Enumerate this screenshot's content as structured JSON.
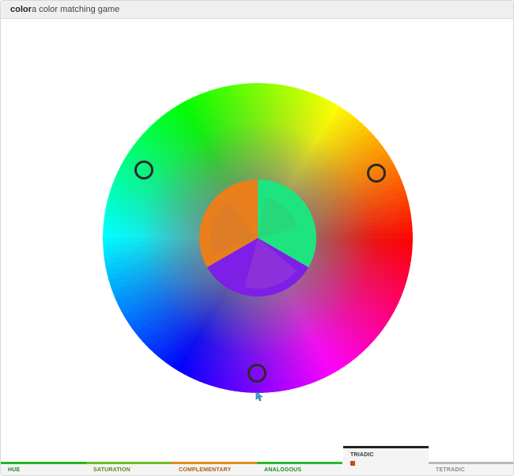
{
  "app": {
    "title": "color",
    "subtitle": "a color matching game"
  },
  "game": {
    "mode": "triadic",
    "target_colors": [
      "#1de47f",
      "#7d1fe7",
      "#e97e1c"
    ],
    "guess_colors": [
      "#27d87b",
      "#8c30dc",
      "#df7d26"
    ],
    "marker_count": 3
  },
  "tabs": [
    {
      "label": "HUE",
      "color": "#27b327",
      "text_color": "#1f8a1f",
      "active": false
    },
    {
      "label": "SATURATION",
      "color": "#6dbb2a",
      "text_color": "#4e8f18",
      "active": false
    },
    {
      "label": "COMPLEMENTARY",
      "color": "#e08a1e",
      "text_color": "#a8620e",
      "active": false
    },
    {
      "label": "ANALOGOUS",
      "color": "#2eb82e",
      "text_color": "#1f8a1f",
      "active": false
    },
    {
      "label": "TRIADIC",
      "color": "#222222",
      "text_color": "#333333",
      "active": true
    },
    {
      "label": "TETRADIC",
      "color": "#b8b8b8",
      "text_color": "#8a8a8a",
      "active": false
    }
  ]
}
